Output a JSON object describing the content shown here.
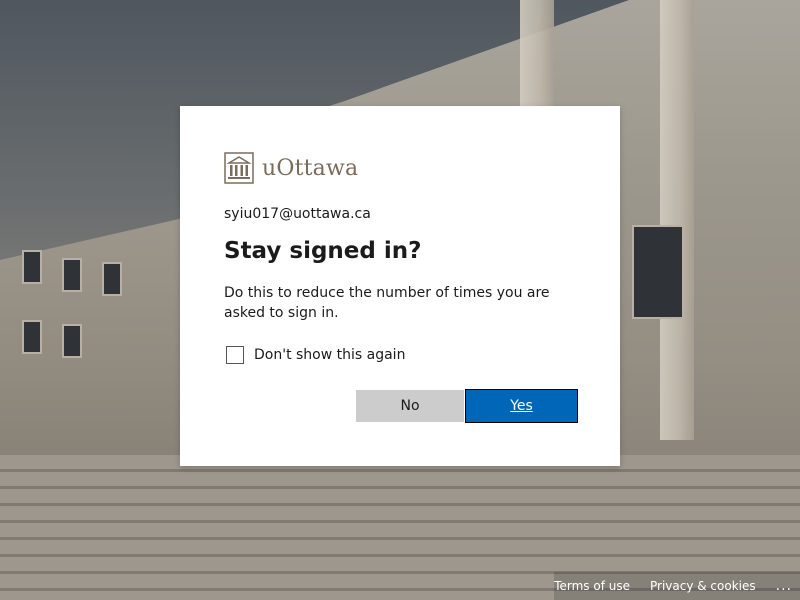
{
  "brand": {
    "logo_text": "uOttawa"
  },
  "identity": {
    "account": "syiu017@uottawa.ca"
  },
  "prompt": {
    "title": "Stay signed in?",
    "description": "Do this to reduce the number of times you are asked to sign in.",
    "checkbox_label": "Don't show this again",
    "checkbox_checked": false
  },
  "buttons": {
    "no_label": "No",
    "yes_label": "Yes"
  },
  "footer": {
    "terms": "Terms of use",
    "privacy": "Privacy & cookies",
    "more": "..."
  },
  "colors": {
    "accent": "#0067b8",
    "secondary_button": "#cccccc",
    "brand_text": "#7a6b5a"
  },
  "icons": {
    "logo": "university-building-icon",
    "more": "ellipsis-icon"
  }
}
